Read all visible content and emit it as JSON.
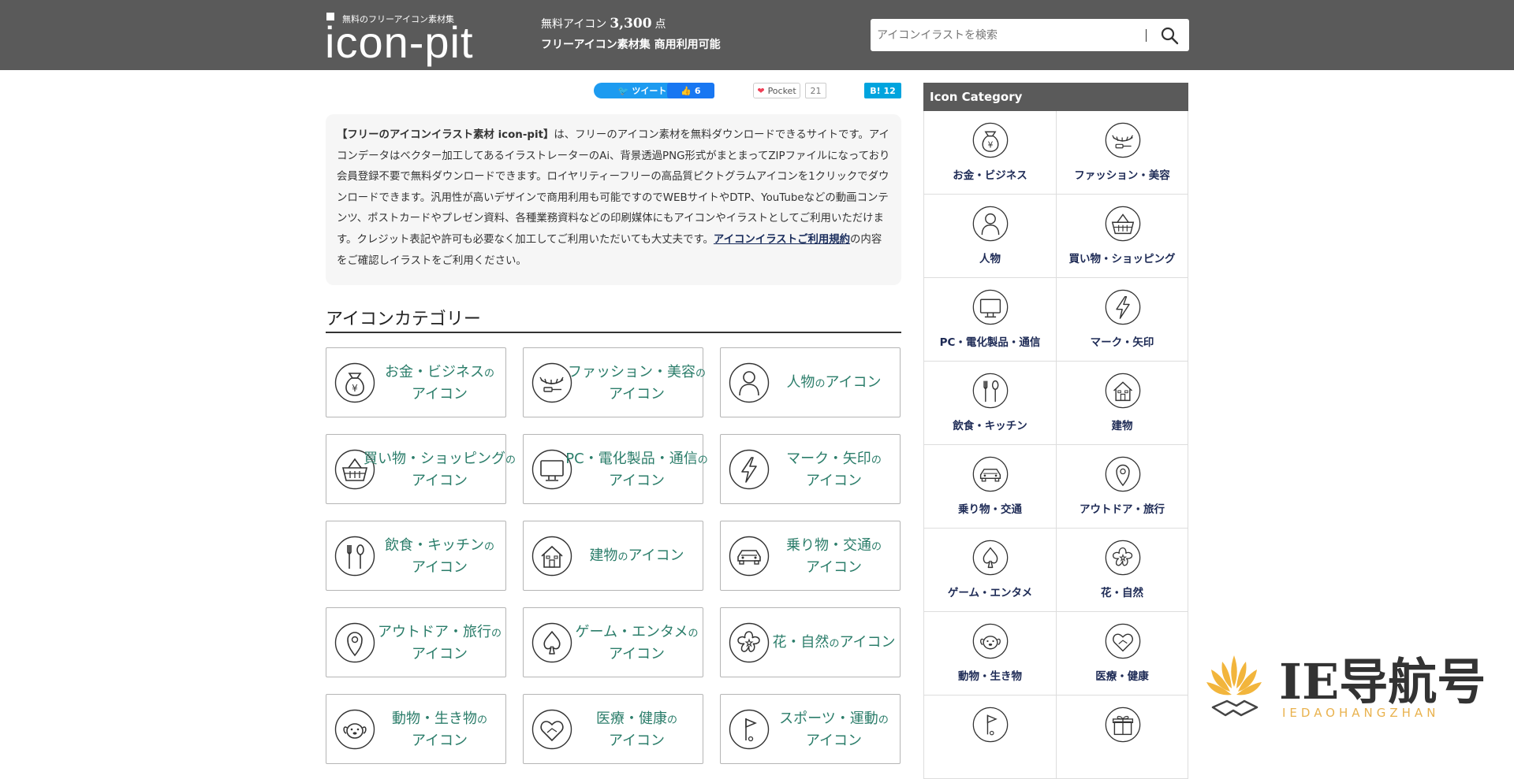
{
  "header": {
    "logo_sub": "無料のフリーアイコン素材集",
    "logo_main": "icon-pit",
    "tagline_prefix": "無料アイコン",
    "tagline_count": "3,300",
    "tagline_unit": "点",
    "tagline_line2": "フリーアイコン素材集 商用利用可能",
    "search_placeholder": "アイコンイラストを検索"
  },
  "social": {
    "tweet": "ツイート",
    "like": "👍 6",
    "pocket": "Pocket",
    "pocket_count": "21",
    "hatena": "B! 12"
  },
  "intro": {
    "bold": "【フリーのアイコンイラスト素材 icon-pit】",
    "text": "は、フリーのアイコン素材を無料ダウンロードできるサイトです。アイコンデータはベクター加工してあるイラストレーターのAi、背景透過PNG形式がまとまってZIPファイルになっており会員登録不要で無料ダウンロードできます。ロイヤリティーフリーの高品質ピクトグラムアイコンを1クリックでダウンロードできます。汎用性が高いデザインで商用利用も可能ですのでWEBサイトやDTP、YouTubeなどの動画コンテンツ、ポストカードやプレゼン資料、各種業務資料などの印刷媒体にもアイコンやイラストとしてご利用いただけます。クレジット表記や許可も必要なく加工してご利用いただいても大丈夫です。",
    "link": "アイコンイラストご利用規約",
    "tail": "の内容をご確認しイラストをご利用ください。"
  },
  "section_title": "アイコンカテゴリー",
  "cards": [
    {
      "line1": "お金・ビジネス",
      "no1": "の",
      "line2": "アイコン",
      "icon": "money-bag-icon"
    },
    {
      "line1": "ファッション・美容",
      "no1": "の",
      "line2": "アイコン",
      "icon": "eyelash-icon"
    },
    {
      "line1": "人物",
      "no1": "の",
      "line2": "アイコン",
      "icon": "person-icon",
      "single": true
    },
    {
      "line1": "買い物・ショッピング",
      "no1": "の",
      "line2": "アイコン",
      "icon": "basket-icon"
    },
    {
      "line1": "PC・電化製品・通信",
      "no1": "の",
      "line2": "アイコン",
      "icon": "monitor-icon"
    },
    {
      "line1": "マーク・矢印",
      "no1": "の",
      "line2": "アイコン",
      "icon": "lightning-icon"
    },
    {
      "line1": "飲食・キッチン",
      "no1": "の",
      "line2": "アイコン",
      "icon": "cutlery-icon"
    },
    {
      "line1": "建物",
      "no1": "の",
      "line2": "アイコン",
      "icon": "house-icon",
      "single": true
    },
    {
      "line1": "乗り物・交通",
      "no1": "の",
      "line2": "アイコン",
      "icon": "car-icon"
    },
    {
      "line1": "アウトドア・旅行",
      "no1": "の",
      "line2": "アイコン",
      "icon": "map-pin-icon"
    },
    {
      "line1": "ゲーム・エンタメ",
      "no1": "の",
      "line2": "アイコン",
      "icon": "spade-icon"
    },
    {
      "line1": "花・自然",
      "no1": "の",
      "line2": "アイコン",
      "icon": "flower-icon",
      "single": true
    },
    {
      "line1": "動物・生き物",
      "no1": "の",
      "line2": "アイコン",
      "icon": "dog-icon"
    },
    {
      "line1": "医療・健康",
      "no1": "の",
      "line2": "アイコン",
      "icon": "heart-hand-icon"
    },
    {
      "line1": "スポーツ・運動",
      "no1": "の",
      "line2": "アイコン",
      "icon": "golf-flag-icon"
    }
  ],
  "sidebar": {
    "title": "Icon Category",
    "items": [
      {
        "label": "お金・ビジネス",
        "icon": "money-bag-icon"
      },
      {
        "label": "ファッション・美容",
        "icon": "eyelash-icon"
      },
      {
        "label": "人物",
        "icon": "person-icon"
      },
      {
        "label": "買い物・ショッピング",
        "icon": "basket-icon"
      },
      {
        "label": "PC・電化製品・通信",
        "icon": "monitor-icon"
      },
      {
        "label": "マーク・矢印",
        "icon": "lightning-icon"
      },
      {
        "label": "飲食・キッチン",
        "icon": "cutlery-icon"
      },
      {
        "label": "建物",
        "icon": "house-icon"
      },
      {
        "label": "乗り物・交通",
        "icon": "car-icon"
      },
      {
        "label": "アウトドア・旅行",
        "icon": "map-pin-icon"
      },
      {
        "label": "ゲーム・エンタメ",
        "icon": "spade-icon"
      },
      {
        "label": "花・自然",
        "icon": "flower-icon"
      },
      {
        "label": "動物・生き物",
        "icon": "dog-icon"
      },
      {
        "label": "医療・健康",
        "icon": "heart-hand-icon"
      },
      {
        "label": "",
        "icon": "golf-flag-icon"
      },
      {
        "label": "",
        "icon": "gift-icon"
      }
    ]
  },
  "watermark": {
    "text": "IE导航号",
    "sub": "IEDAOHANGZHAN"
  },
  "colors": {
    "header_bg": "#5a5a5a",
    "card_text": "#2b7d6a",
    "sidebar_label": "#1d2a55",
    "tweet": "#1d9bf0",
    "like": "#1877f2",
    "hatena": "#00a4de"
  }
}
